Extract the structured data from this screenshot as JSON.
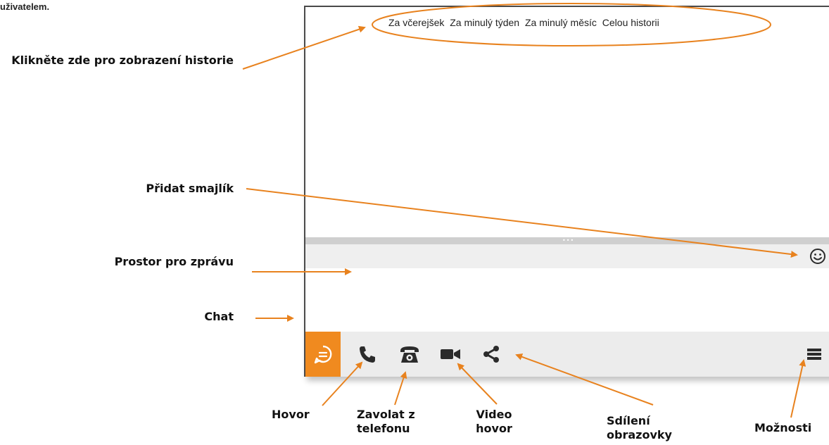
{
  "intro_text": "uživatelem.",
  "callouts": {
    "history": "Klikněte zde pro zobrazení historie",
    "smiley": "Přidat smajlík",
    "message_space": "Prostor pro zprávu",
    "chat": "Chat",
    "call": "Hovor",
    "phone_call": "Zavolat z telefonu",
    "video_call": "Video hovor",
    "screen_share": "Sdílení obrazovky",
    "options": "Možnosti"
  },
  "history_links": [
    "Za včerejšek",
    "Za minulý týden",
    "Za minulý měsíc",
    "Celou historii"
  ],
  "toolbar_icons": [
    "chat-icon",
    "phone-icon",
    "desk-phone-icon",
    "video-camera-icon",
    "share-icon",
    "menu-icon"
  ],
  "colors": {
    "accent": "#f08a1f",
    "arrow": "#e8821e",
    "toolbar_bg": "#ececec",
    "icon": "#2b2b2b"
  }
}
